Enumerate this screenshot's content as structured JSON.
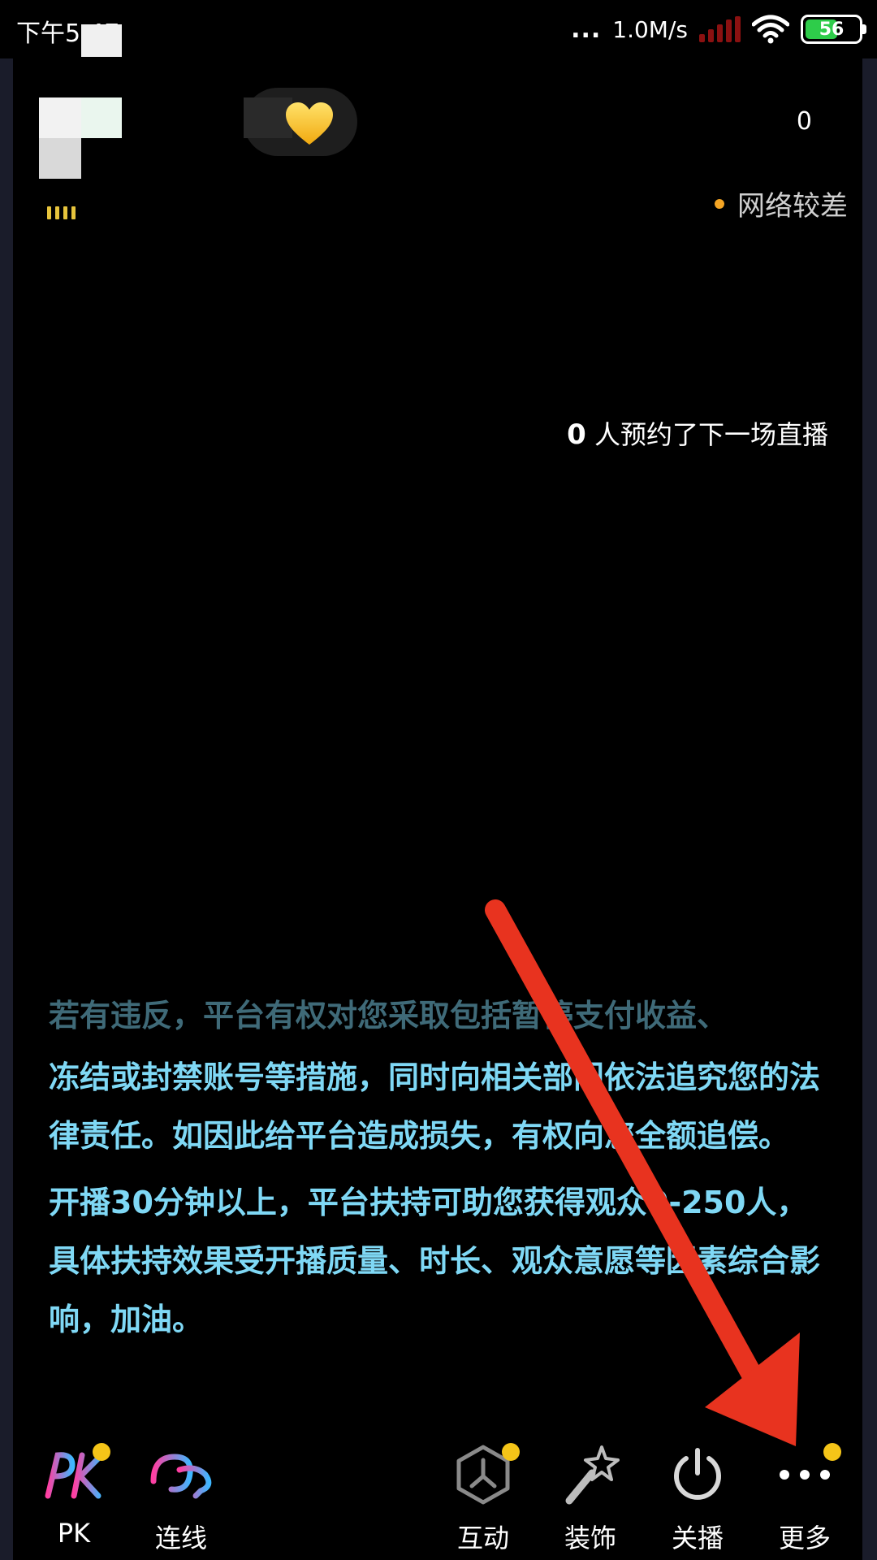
{
  "status_bar": {
    "time": "下午5:47",
    "network_dots": "...",
    "speed": "1.0M/s",
    "battery": "56"
  },
  "header": {
    "viewer_count": "0",
    "network_status": "网络较差"
  },
  "reservation": {
    "count": "0",
    "text": "人预约了下一场直播"
  },
  "notice": {
    "faded_line": "若有违反，平台有权对您采取包括暂停支付收益、",
    "paragraph1": "冻结或封禁账号等措施，同时向相关部门依法追究您的法律责任。如因此给平台造成损失，有权向您全额追偿。",
    "paragraph2": "开播30分钟以上，平台扶持可助您获得观众0-250人，具体扶持效果受开播质量、时长、观众意愿等因素综合影响，加油。"
  },
  "toolbar": {
    "pk_label": "PK",
    "link_label": "连线",
    "interact_label": "互动",
    "decorate_label": "装饰",
    "stop_label": "关播",
    "more_label": "更多"
  },
  "colors": {
    "notice_text": "#7fd8f5",
    "badge": "#f5c518",
    "arrow": "#e8331f",
    "network_dot": "#f5a524"
  }
}
